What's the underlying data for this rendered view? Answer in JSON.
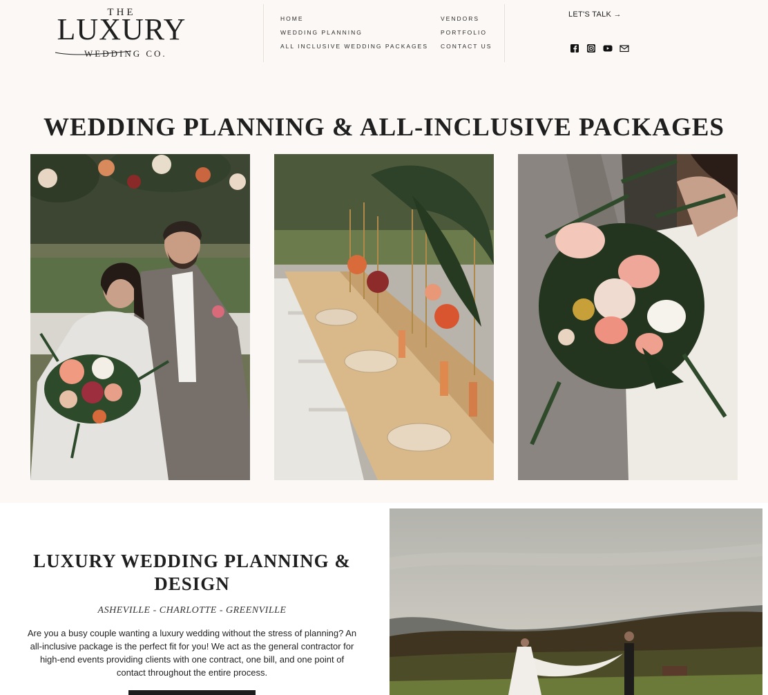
{
  "brand": {
    "the": "THE",
    "name": "LUXURY",
    "sub": "WEDDING CO."
  },
  "nav": {
    "left": [
      "HOME",
      "WEDDING PLANNING",
      "ALL INCLUSIVE WEDDING PACKAGES"
    ],
    "right": [
      "VENDORS",
      "PORTFOLIO",
      "CONTACT US"
    ]
  },
  "cta": {
    "lets_talk": "LET'S TALK →"
  },
  "social_icons": [
    "facebook-icon",
    "instagram-icon",
    "youtube-icon",
    "email-icon"
  ],
  "hero": {
    "title": "WEDDING PLANNING & ALL-INCLUSIVE PACKAGES",
    "photos": [
      "couple-seated-with-bouquet",
      "reception-table-setting",
      "bride-holding-tropical-bouquet"
    ]
  },
  "planning": {
    "title": "LUXURY WEDDING PLANNING & DESIGN",
    "cities": "ASHEVILLE - CHARLOTTE - GREENVILLE",
    "description": "Are you a busy couple wanting a luxury wedding without the stress of planning? An all-inclusive package is the perfect fit for you! We act as the general contractor for high-end events providing clients with one contract, one bill, and one point of contact throughout the entire process."
  },
  "colors": {
    "background": "#fbf8f5",
    "text": "#1b1b1b",
    "accent_dark": "#1c1c1c"
  }
}
